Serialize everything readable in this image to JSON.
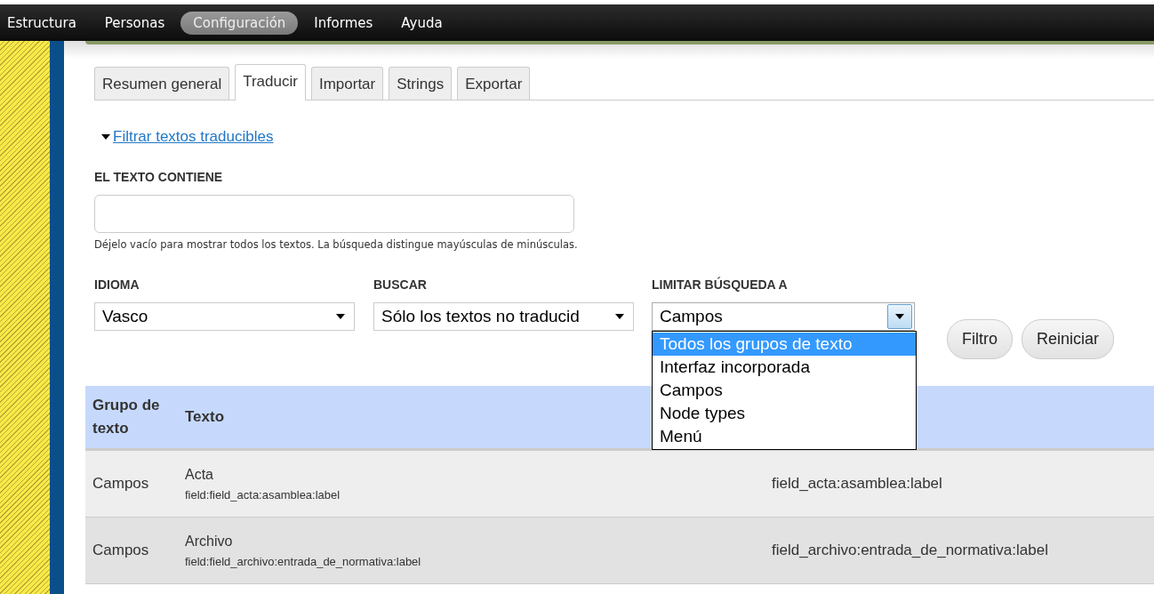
{
  "nav": [
    {
      "label": "Estructura",
      "selected": false
    },
    {
      "label": "Personas",
      "selected": false
    },
    {
      "label": "Configuración",
      "selected": true
    },
    {
      "label": "Informes",
      "selected": false
    },
    {
      "label": "Ayuda",
      "selected": false
    }
  ],
  "tabs": [
    {
      "label": "Resumen general",
      "selected": false
    },
    {
      "label": "Traducir",
      "selected": true
    },
    {
      "label": "Importar",
      "selected": false
    },
    {
      "label": "Strings",
      "selected": false
    },
    {
      "label": "Exportar",
      "selected": false
    }
  ],
  "filter_toggle": {
    "label": "Filtrar textos traducibles",
    "expanded": true
  },
  "text_field": {
    "label": "EL TEXTO CONTIENE",
    "help": "Déjelo vacío para mostrar todos los textos. La búsqueda distingue mayúsculas de minúsculas."
  },
  "selects": [
    {
      "label": "IDIOMA",
      "value": "Vasco",
      "open": false
    },
    {
      "label": "BUSCAR",
      "value": "Sólo los textos no traducid",
      "open": false
    },
    {
      "label": "LIMITAR BÚSQUEDA A",
      "value": "Campos",
      "open": true,
      "options": [
        {
          "label": "Todos los grupos de texto",
          "highlighted": true
        },
        {
          "label": "Interfaz incorporada",
          "highlighted": false
        },
        {
          "label": "Campos",
          "highlighted": false
        },
        {
          "label": "Node types",
          "highlighted": false
        },
        {
          "label": "Menú",
          "highlighted": false
        }
      ]
    }
  ],
  "buttons": [
    "Filtro",
    "Reiniciar"
  ],
  "table": {
    "columns": [
      "Grupo de\ntexto",
      "Texto"
    ],
    "rows": [
      {
        "group": "Campos",
        "text": "Acta",
        "source": "field:field_acta:asamblea:label",
        "context": "field_acta:asamblea:label"
      },
      {
        "group": "Campos",
        "text": "Archivo",
        "source": "field:field_archivo:entrada_de_normativa:label",
        "context": "field_archivo:entrada_de_normativa:label"
      }
    ]
  }
}
